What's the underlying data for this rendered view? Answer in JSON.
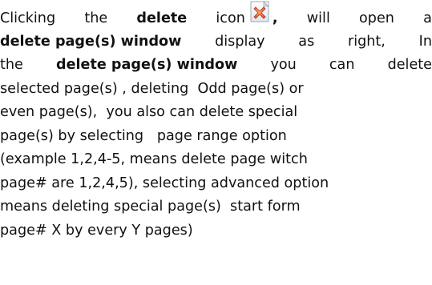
{
  "paragraph": {
    "l1": {
      "a": "Clicking",
      "b": "the",
      "c": "delete",
      "d": "icon",
      "e": ",",
      "f": "will",
      "g": "open",
      "h": "a"
    },
    "l2": {
      "a": "delete page(s) window",
      "b": "display",
      "c": "as",
      "d": "right,",
      "e": "In"
    },
    "l3": {
      "a": "the",
      "b": "delete page(s) window",
      "c": "you",
      "d": "can",
      "e": "delete"
    },
    "l4": "selected page(s) , deleting  Odd page(s) or",
    "l5": "even page(s),  you also can delete special",
    "l6": "page(s) by selecting   page range option",
    "l7": "(example 1,2,4-5, means delete page witch",
    "l8": "page# are 1,2,4,5), selecting advanced option",
    "l9": "means deleting special page(s)  start form",
    "l10": "page# X by every Y pages)"
  },
  "icons": {
    "delete": "delete-page-icon"
  },
  "colors": {
    "text": "#111111",
    "icon_page": "#f3f6f9",
    "icon_x": "#e0492a"
  }
}
